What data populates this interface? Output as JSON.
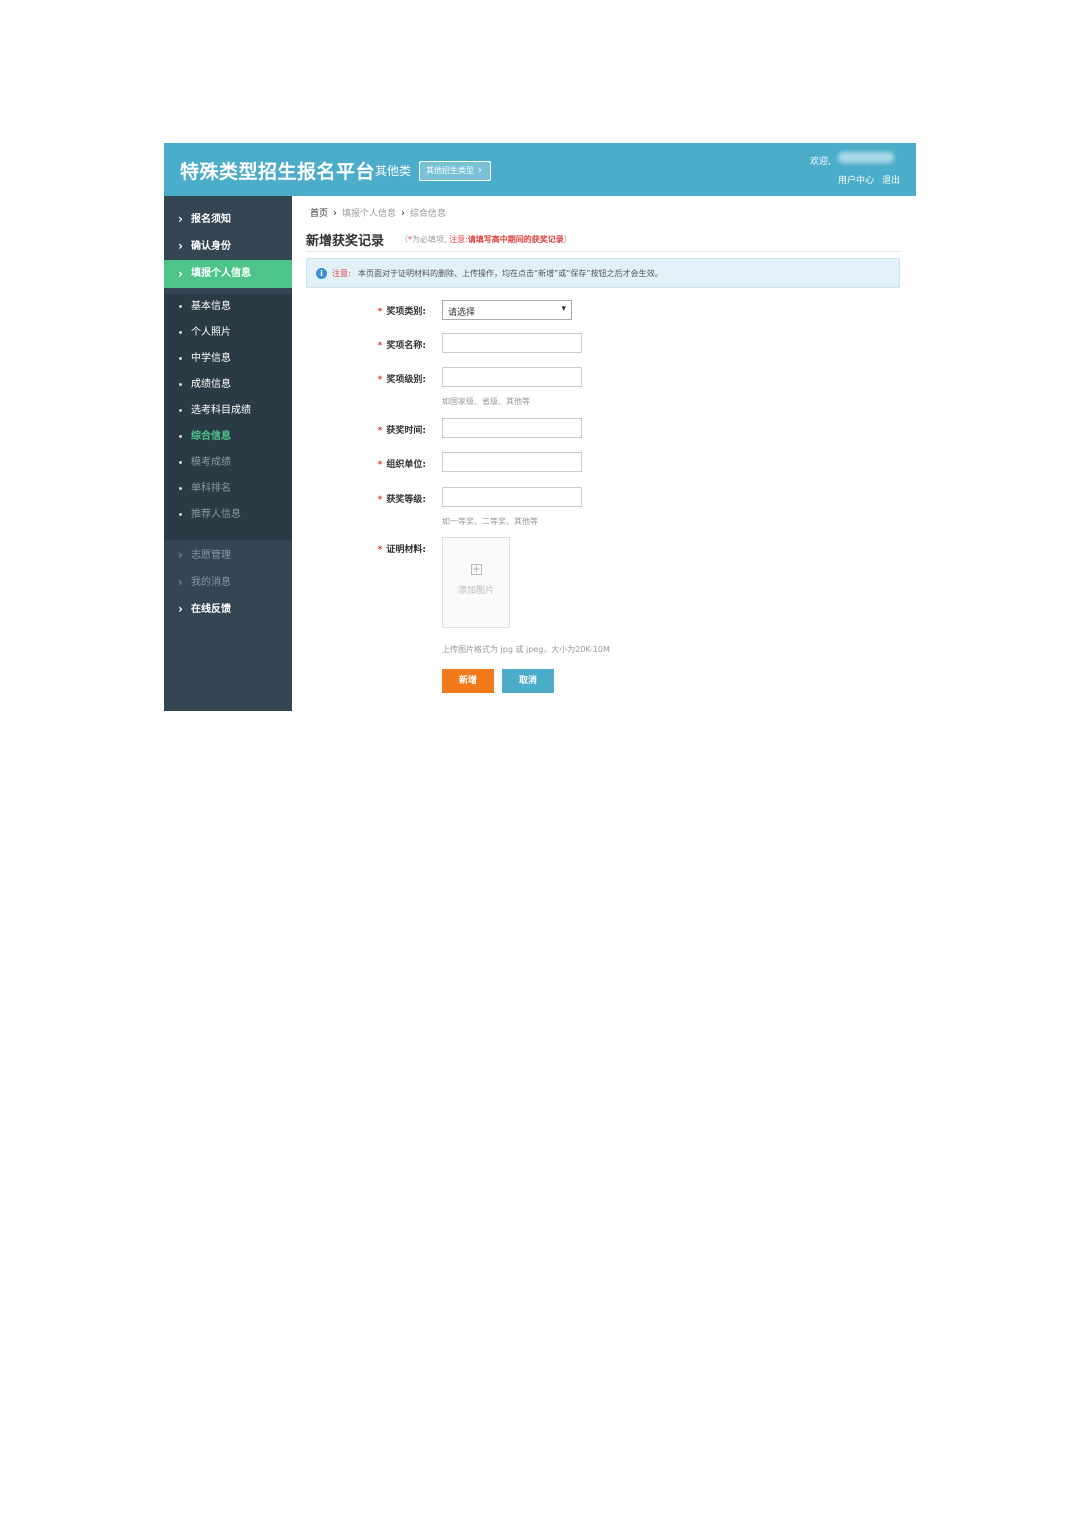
{
  "header": {
    "title": "特殊类型招生报名平台",
    "category": "其他类",
    "category_button": "其他招生类型",
    "category_button_icon": "chevron-right-icon",
    "welcome": "欢迎,",
    "user_center": "用户中心",
    "logout": "退出",
    "bg_color": "#4badc9"
  },
  "sidebar": {
    "top_items": [
      {
        "label": "报名须知"
      },
      {
        "label": "确认身份"
      },
      {
        "label": "填报个人信息",
        "active": true
      }
    ],
    "sub_items": [
      {
        "label": "基本信息"
      },
      {
        "label": "个人照片"
      },
      {
        "label": "中学信息"
      },
      {
        "label": "成绩信息"
      },
      {
        "label": "选考科目成绩"
      },
      {
        "label": "综合信息",
        "current": true
      },
      {
        "label": "模考成绩"
      },
      {
        "label": "单科排名"
      },
      {
        "label": "推荐人信息"
      }
    ],
    "bottom_items": [
      {
        "label": "志愿管理"
      },
      {
        "label": "我的消息"
      },
      {
        "label": "在线反馈"
      }
    ],
    "active_color": "#4ec38a",
    "bg_color": "#344652"
  },
  "breadcrumb": {
    "home": "首页",
    "level2": "填报个人信息",
    "level3": "综合信息"
  },
  "page": {
    "title": "新增获奖记录",
    "note_open": "（",
    "note_star": "*",
    "note_required": "为必填项,",
    "note_attention": "注意:",
    "note_text": "请填写高中期间的获奖记录",
    "note_close": "）"
  },
  "notice": {
    "icon": "info-icon",
    "label": "注意:",
    "text": "本页面对于证明材料的删除、上传操作，均在点击“新增”或“保存”按钮之后才会生效。"
  },
  "form": {
    "award_type": {
      "label": "奖项类别:",
      "value": "请选择"
    },
    "award_name": {
      "label": "奖项名称:",
      "value": ""
    },
    "award_level": {
      "label": "奖项级别:",
      "value": "",
      "hint": "如国家级、省级、其他等"
    },
    "award_date": {
      "label": "获奖时间:",
      "value": ""
    },
    "organizer": {
      "label": "组织单位:",
      "value": ""
    },
    "award_grade": {
      "label": "获奖等级:",
      "value": "",
      "hint": "如一等奖、二等奖、其他等"
    },
    "proof": {
      "label": "证明材料:",
      "upload_label": "添加图片",
      "upload_icon": "plus-square-icon",
      "hint": "上传图片格式为 jpg 或 jpeg，大小为20K-10M"
    },
    "required_mark": "*"
  },
  "buttons": {
    "add": "新增",
    "cancel": "取消",
    "add_color": "#f27a1a",
    "cancel_color": "#4badc9"
  }
}
